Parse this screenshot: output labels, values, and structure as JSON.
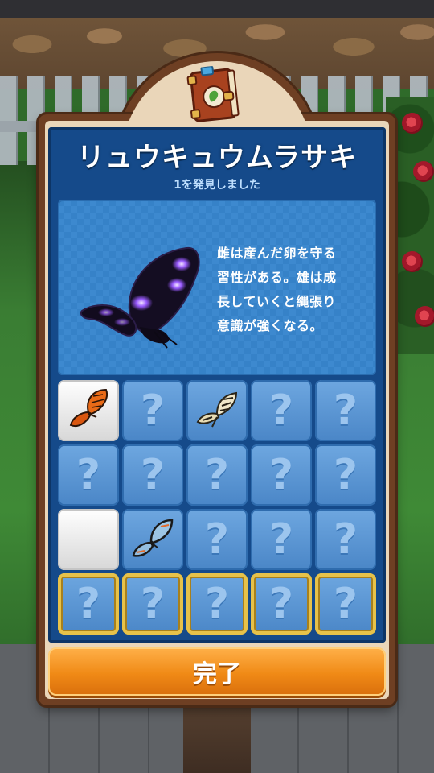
{
  "encyclopedia": {
    "title": "リュウキュウムラサキ",
    "subtitle": "1を発見しました",
    "description": "雌は産んだ卵を守る\n習性がある。雄は成\n長していくと縄張り\n意識が強くなる。",
    "featured_icon": "purple-butterfly"
  },
  "grid": {
    "columns": 5,
    "rows": 4,
    "cells": [
      {
        "state": "found",
        "icon": "orange-butterfly"
      },
      {
        "state": "unknown",
        "label": "?"
      },
      {
        "state": "found-blue",
        "icon": "swallowtail-butterfly"
      },
      {
        "state": "unknown",
        "label": "?"
      },
      {
        "state": "unknown",
        "label": "?"
      },
      {
        "state": "unknown",
        "label": "?"
      },
      {
        "state": "unknown",
        "label": "?"
      },
      {
        "state": "unknown",
        "label": "?"
      },
      {
        "state": "unknown",
        "label": "?"
      },
      {
        "state": "unknown",
        "label": "?"
      },
      {
        "state": "empty-white"
      },
      {
        "state": "found-blue",
        "icon": "clearwing-butterfly"
      },
      {
        "state": "unknown",
        "label": "?"
      },
      {
        "state": "unknown",
        "label": "?"
      },
      {
        "state": "unknown",
        "label": "?"
      },
      {
        "state": "unknown-gold",
        "label": "?"
      },
      {
        "state": "unknown-gold",
        "label": "?"
      },
      {
        "state": "unknown-gold",
        "label": "?"
      },
      {
        "state": "unknown-gold",
        "label": "?"
      },
      {
        "state": "unknown-gold",
        "label": "?"
      }
    ]
  },
  "footer": {
    "done_label": "完了"
  },
  "colors": {
    "panel": "#154a8a",
    "frame": "#6e3f23",
    "button": "#f08a16",
    "gold_border": "#e7c24a"
  }
}
